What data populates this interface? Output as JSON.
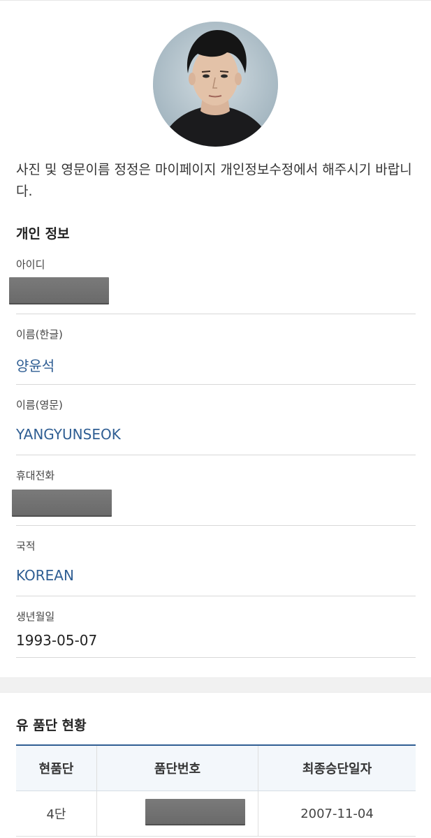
{
  "notice": "사진 및 영문이름 정정은 마이페이지 개인정보수정에서 해주시기 바랍니다.",
  "personal": {
    "title": "개인 정보",
    "fields": [
      {
        "label": "아이디",
        "value": "",
        "redacted": true
      },
      {
        "label": "이름(한글)",
        "value": "양윤석"
      },
      {
        "label": "이름(영문)",
        "value": "YANGYUNSEOK"
      },
      {
        "label": "휴대전화",
        "value": "",
        "redacted": true
      },
      {
        "label": "국적",
        "value": "KOREAN"
      },
      {
        "label": "생년월일",
        "value": "1993-05-07"
      }
    ]
  },
  "rank": {
    "title": "유 품단 현황",
    "headers": [
      "현품단",
      "품단번호",
      "최종승단일자"
    ],
    "rows": [
      {
        "level": "4단",
        "number": "",
        "number_redacted": true,
        "date": "2007-11-04"
      }
    ]
  },
  "colors": {
    "accent": "#2f5e93",
    "value_blue": "#2f5e93",
    "rule": "#d8d8d8"
  }
}
